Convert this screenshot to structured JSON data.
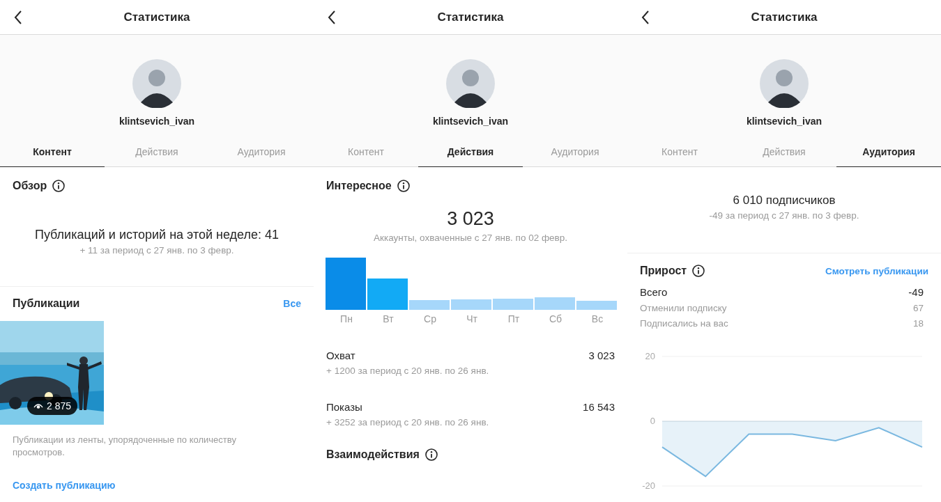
{
  "panels": [
    {
      "kind": "content",
      "title": "Статистика",
      "username": "klintsevich_ivan",
      "tabs": [
        {
          "label": "Контент",
          "selected": true
        },
        {
          "label": "Действия",
          "selected": false
        },
        {
          "label": "Аудитория",
          "selected": false
        }
      ],
      "overview": {
        "title": "Обзор",
        "headline": "Публикаций и историй на этой неделе: 41",
        "sub": "+ 11 за период с 27 янв. по 3 февр."
      },
      "posts": {
        "title": "Публикации",
        "all_link": "Все",
        "items": [
          {
            "kind": "picture",
            "views": "2 875"
          }
        ],
        "caption": "Публикации из ленты, упорядоченные по количеству просмотров.",
        "create_link": "Создать публикацию"
      }
    },
    {
      "kind": "activity",
      "title": "Статистика",
      "username": "klintsevich_ivan",
      "tabs": [
        {
          "label": "Контент",
          "selected": false
        },
        {
          "label": "Действия",
          "selected": true
        },
        {
          "label": "Аудитория",
          "selected": false
        }
      ],
      "discovery": {
        "title": "Интересное",
        "value": "3 023",
        "sub": "Аккаунты, охваченные с 27 янв. по 02 февр.",
        "days": [
          "Пн",
          "Вт",
          "Ср",
          "Чт",
          "Пт",
          "Сб",
          "Вс"
        ]
      },
      "metrics": [
        {
          "label": "Охват",
          "value": "3 023",
          "sub": "+ 1200 за период с 20 янв. по 26 янв."
        },
        {
          "label": "Показы",
          "value": "16 543",
          "sub": "+ 3252 за период с 20 янв. по 26 янв."
        }
      ],
      "interactions_title": "Взаимодействия"
    },
    {
      "kind": "audience",
      "title": "Статистика",
      "username": "klintsevich_ivan",
      "tabs": [
        {
          "label": "Контент",
          "selected": false
        },
        {
          "label": "Действия",
          "selected": false
        },
        {
          "label": "Аудитория",
          "selected": true
        }
      ],
      "followers": {
        "count": "6 010 подписчиков",
        "sub": "-49 за период с 27 янв. по 3 февр."
      },
      "growth": {
        "title": "Прирост",
        "link": "Смотреть публикации",
        "rows": [
          {
            "kind": "total",
            "label": "Всего",
            "value": "-49"
          },
          {
            "kind": "detail",
            "label": "Отменили подписку",
            "value": "67"
          },
          {
            "kind": "detail",
            "label": "Подписались на вас",
            "value": "18"
          }
        ],
        "chart_data": {
          "type": "area",
          "ylim": [
            -20,
            20
          ],
          "yticks": [
            20,
            0,
            -20
          ],
          "series": [
            {
              "color": "#7ab8e0",
              "values": [
                -8,
                -17,
                -4,
                -4,
                -6,
                -2,
                -8
              ]
            }
          ]
        }
      }
    }
  ]
}
